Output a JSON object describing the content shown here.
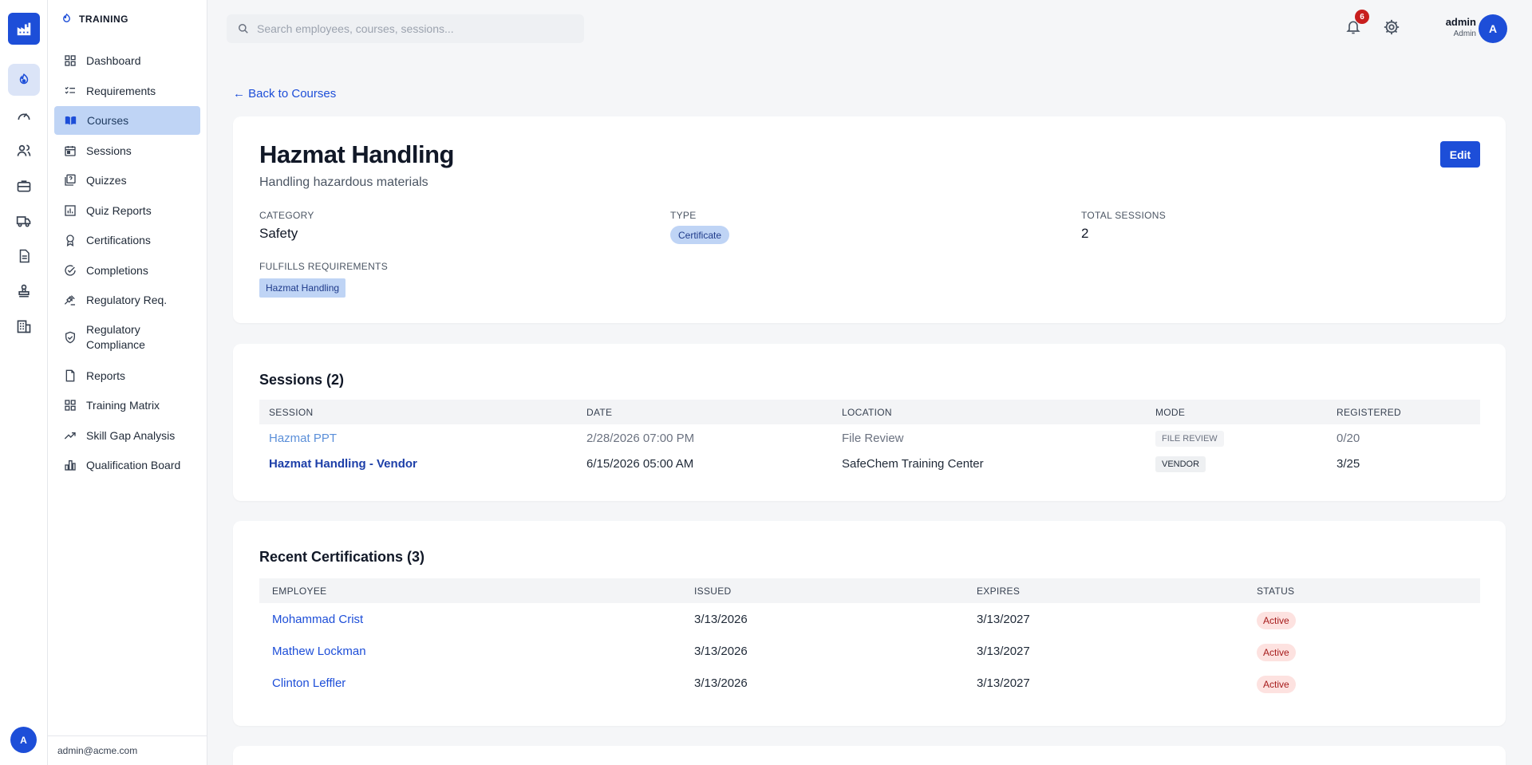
{
  "app": {
    "section": "TRAINING"
  },
  "rail": {
    "icons": [
      "factory-icon",
      "training-icon",
      "gauge-icon",
      "people-icon",
      "briefcase-icon",
      "truck-icon",
      "document-icon",
      "stamp-icon",
      "building-icon"
    ],
    "avatar": "A"
  },
  "sidebar": {
    "items": [
      {
        "label": "Dashboard",
        "icon": "grid-icon"
      },
      {
        "label": "Requirements",
        "icon": "checklist-icon"
      },
      {
        "label": "Courses",
        "icon": "book-open-icon",
        "active": true
      },
      {
        "label": "Sessions",
        "icon": "calendar-icon"
      },
      {
        "label": "Quizzes",
        "icon": "quiz-icon"
      },
      {
        "label": "Quiz Reports",
        "icon": "bar-report-icon"
      },
      {
        "label": "Certifications",
        "icon": "award-icon"
      },
      {
        "label": "Completions",
        "icon": "check-circle-icon"
      },
      {
        "label": "Regulatory Req.",
        "icon": "gavel-icon"
      },
      {
        "label": "Regulatory Compliance",
        "icon": "shield-check-icon"
      },
      {
        "label": "Reports",
        "icon": "report-icon"
      },
      {
        "label": "Training Matrix",
        "icon": "matrix-icon"
      },
      {
        "label": "Skill Gap Analysis",
        "icon": "trending-icon"
      },
      {
        "label": "Qualification Board",
        "icon": "bar-chart-icon"
      }
    ],
    "footer_email": "admin@acme.com"
  },
  "topbar": {
    "search_placeholder": "Search employees, courses, sessions...",
    "notification_count": "6",
    "user_name": "admin",
    "user_role": "Admin",
    "user_initial": "A"
  },
  "back_link": "← Back to Courses",
  "course": {
    "title": "Hazmat Handling",
    "subtitle": "Handling hazardous materials",
    "edit_label": "Edit",
    "category_label": "CATEGORY",
    "category": "Safety",
    "type_label": "TYPE",
    "type": "Certificate",
    "total_sessions_label": "TOTAL SESSIONS",
    "total_sessions": "2",
    "fulfills_label": "FULFILLS REQUIREMENTS",
    "fulfills": [
      "Hazmat Handling"
    ]
  },
  "sessions": {
    "title": "Sessions (2)",
    "columns": [
      "SESSION",
      "DATE",
      "LOCATION",
      "MODE",
      "REGISTERED"
    ],
    "rows": [
      {
        "session": "Hazmat PPT",
        "date": "2/28/2026 07:00 PM",
        "location": "File Review",
        "mode": "FILE REVIEW",
        "registered": "0/20",
        "past": true
      },
      {
        "session": "Hazmat Handling - Vendor",
        "date": "6/15/2026 05:00 AM",
        "location": "SafeChem Training Center",
        "mode": "VENDOR",
        "registered": "3/25",
        "past": false
      }
    ]
  },
  "certifications": {
    "title": "Recent Certifications (3)",
    "columns": [
      "EMPLOYEE",
      "ISSUED",
      "EXPIRES",
      "STATUS"
    ],
    "rows": [
      {
        "employee": "Mohammad Crist",
        "issued": "3/13/2026",
        "expires": "3/13/2027",
        "status": "Active"
      },
      {
        "employee": "Mathew Lockman",
        "issued": "3/13/2026",
        "expires": "3/13/2027",
        "status": "Active"
      },
      {
        "employee": "Clinton Leffler",
        "issued": "3/13/2026",
        "expires": "3/13/2027",
        "status": "Active"
      }
    ]
  },
  "colors": {
    "accent": "#1d4ed8",
    "active_nav": "#bfd4f5",
    "badge": "#c81e1e",
    "status_bg": "#fde2e0"
  }
}
